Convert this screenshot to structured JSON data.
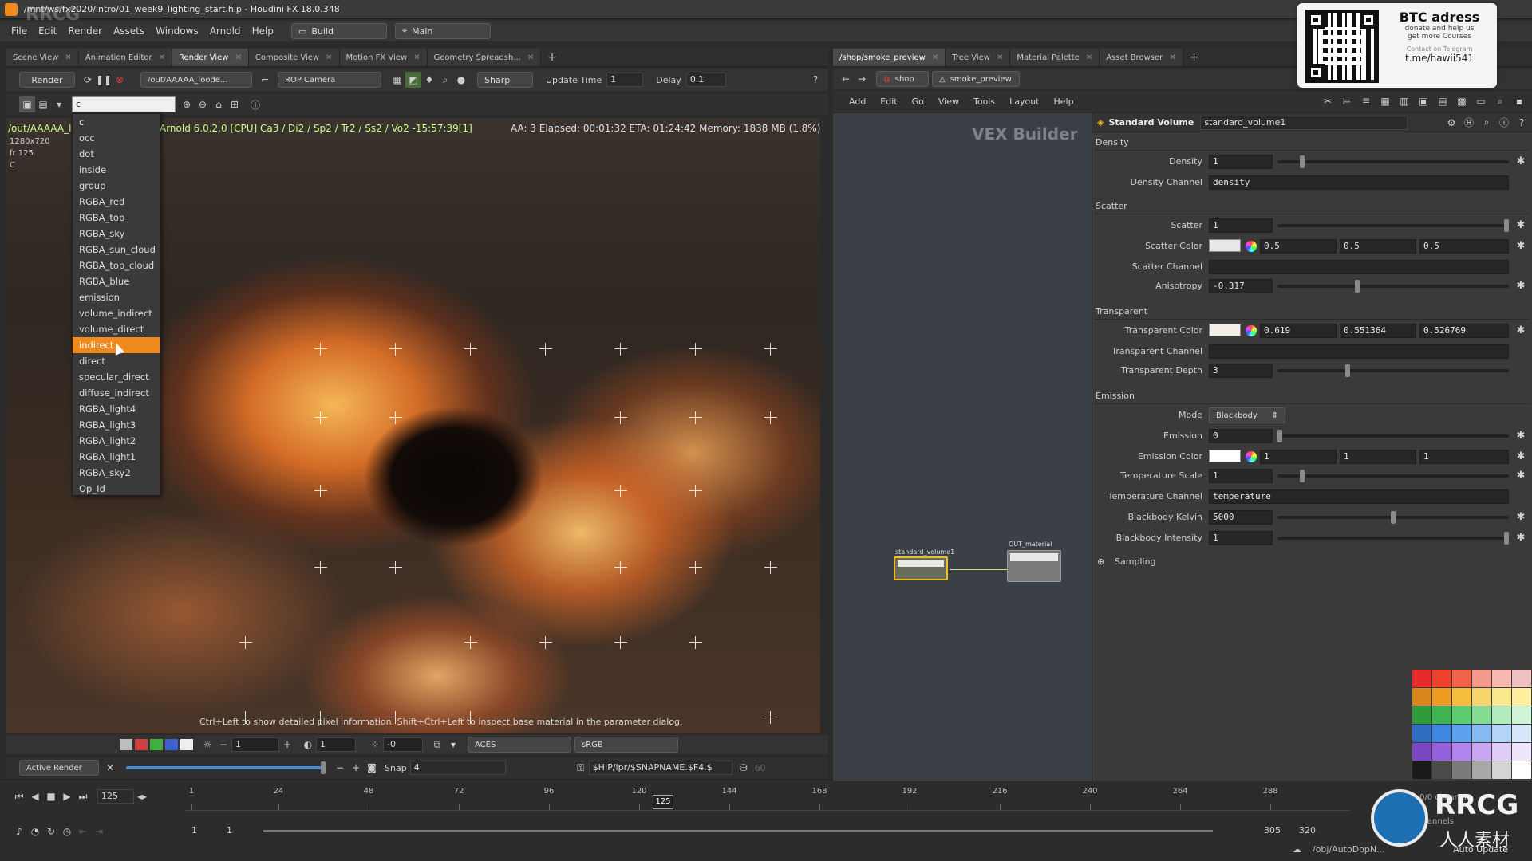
{
  "window": {
    "title": "/mnt/ws/fx2020/intro/01_week9_lighting_start.hip - Houdini FX 18.0.348",
    "watermark_top": "RRCG"
  },
  "menubar": {
    "items": [
      "File",
      "Edit",
      "Render",
      "Assets",
      "Windows",
      "Arnold",
      "Help"
    ],
    "desktop_label": "Build",
    "shelf_label": "Main"
  },
  "left_tabs": [
    "Scene View",
    "Animation Editor",
    "Render View",
    "Composite View",
    "Motion FX View",
    "Geometry Spreadsh..."
  ],
  "left_active_tab": "Render View",
  "render_toolbar": {
    "render_label": "Render",
    "rop_path": "/out/AAAAA_loode...",
    "camera": "ROP Camera",
    "sharp_label": "Sharp",
    "update_time_label": "Update Time",
    "update_time_value": "1",
    "delay_label": "Delay",
    "delay_value": "0.1"
  },
  "aov": {
    "input_value": "c",
    "options": [
      "c",
      "occ",
      "dot",
      "inside",
      "group",
      "RGBA_red",
      "RGBA_top",
      "RGBA_sky",
      "RGBA_sun_cloud",
      "RGBA_top_cloud",
      "RGBA_blue",
      "emission",
      "volume_indirect",
      "volume_direct",
      "indirect",
      "direct",
      "specular_direct",
      "diffuse_indirect",
      "RGBA_light4",
      "RGBA_light3",
      "RGBA_light2",
      "RGBA_light1",
      "RGBA_sky2",
      "Op_Id"
    ],
    "selected": "indirect"
  },
  "viewport": {
    "rop_prefix": "/out/AAAAA_lo",
    "renderer_info": "Arnold 6.0.2.0 [CPU]  Ca3 / Di2 / Sp2 / Tr2 / Ss2 / Vo2 -15:57:39[1]",
    "stats": "AA: 3   Elapsed: 00:01:32   ETA: 01:24:42   Memory: 1838 MB  (1.8%)...",
    "resolution": "1280x720",
    "frame": "fr 125",
    "channel": "C",
    "hint": "Ctrl+Left to show detailed pixel information. Shift+Ctrl+Left to inspect base material in the parameter dialog."
  },
  "viewport_bottom": {
    "exposure_value": "1",
    "gamma_value": "1",
    "offset_value": "-0",
    "display_lut": "ACES",
    "colorspace": "sRGB",
    "active_render": "Active Render",
    "snap_label": "Snap",
    "snap_value": "4",
    "output_path": "$HIP/ipr/$SNAPNAME.$F4.$",
    "output_val": "60"
  },
  "timeline": {
    "current_frame": "125",
    "ticks": [
      "1",
      "24",
      "48",
      "72",
      "96",
      "120",
      "144",
      "168",
      "192",
      "216",
      "240",
      "264",
      "288"
    ],
    "marker": "125",
    "range_start": "1",
    "range_start2": "1",
    "range_end": "305",
    "range_end2": "320",
    "keys_label": "keys, 0/0 channels",
    "all_channels": "All Channels"
  },
  "right_tabs": [
    "/shop/smoke_preview",
    "Tree View",
    "Material Palette",
    "Asset Browser"
  ],
  "path_bar": {
    "context": "shop",
    "node": "smoke_preview"
  },
  "network_menu": [
    "Add",
    "Edit",
    "Go",
    "View",
    "Tools",
    "Layout",
    "Help"
  ],
  "network": {
    "title": "VEX Builder",
    "node1": "standard_volume1",
    "node2": "OUT_material"
  },
  "params": {
    "node_type": "Standard Volume",
    "node_name": "standard_volume1",
    "sections": {
      "density": "Density",
      "scatter": "Scatter",
      "transparent": "Transparent",
      "emission": "Emission",
      "sampling": "Sampling"
    },
    "density": {
      "label": "Density",
      "value": "1",
      "channel_label": "Density Channel",
      "channel_value": "density",
      "slider": 0.1
    },
    "scatter": {
      "label": "Scatter",
      "value": "1",
      "slider": 1.0,
      "color_label": "Scatter Color",
      "color": [
        "0.5",
        "0.5",
        "0.5"
      ],
      "channel_label": "Scatter Channel",
      "channel_value": "",
      "aniso_label": "Anisotropy",
      "aniso_value": "-0.317",
      "aniso_slider": 0.34
    },
    "transparent": {
      "color_label": "Transparent Color",
      "color": [
        "0.619",
        "0.551364",
        "0.526769"
      ],
      "channel_label": "Transparent Channel",
      "channel_value": "",
      "depth_label": "Transparent Depth",
      "depth_value": "3",
      "depth_slider": 0.3
    },
    "emission": {
      "mode_label": "Mode",
      "mode_value": "Blackbody",
      "emission_label": "Emission",
      "emission_value": "0",
      "emission_slider": 0.0,
      "color_label": "Emission Color",
      "color": [
        "1",
        "1",
        "1"
      ],
      "temp_scale_label": "Temperature Scale",
      "temp_scale_value": "1",
      "temp_scale_slider": 0.1,
      "temp_channel_label": "Temperature Channel",
      "temp_channel_value": "temperature",
      "kelvin_label": "Blackbody Kelvin",
      "kelvin_value": "5000",
      "kelvin_slider": 0.5,
      "intensity_label": "Blackbody Intensity",
      "intensity_value": "1",
      "intensity_slider": 1.0
    }
  },
  "palette_colors": [
    "#e52b2b",
    "#f0412c",
    "#f2624a",
    "#f59a8c",
    "#f7b9b0",
    "#f0c0c0",
    "#d8871c",
    "#ee9c22",
    "#f4be3a",
    "#f6d66a",
    "#f8e98a",
    "#fff0a0",
    "#2f9b3a",
    "#3fb552",
    "#5ccd6e",
    "#84dc94",
    "#b3ebbf",
    "#d0f4d6",
    "#2e6fc2",
    "#3f86e0",
    "#5da2ee",
    "#85baf2",
    "#b3d3f7",
    "#d6e7fb",
    "#7a49c2",
    "#9460de",
    "#b284ee",
    "#c9a8f3",
    "#e0cef8",
    "#f0e6fb",
    "#1a1a1a",
    "#4a4a4a",
    "#7a7a7a",
    "#a8a8a8",
    "#d4d4d4",
    "#ffffff"
  ],
  "overlay": {
    "heading": "BTC adress",
    "line1": "donate and help us",
    "line2": "get more Courses",
    "line3": "Contact on Telegram",
    "handle": "t.me/hawii541"
  },
  "status": {
    "path": "/obj/AutoDopN...",
    "update_mode": "Auto Update"
  },
  "rrcg_logo": {
    "brand": "RRCG",
    "sub": "人人素材"
  }
}
